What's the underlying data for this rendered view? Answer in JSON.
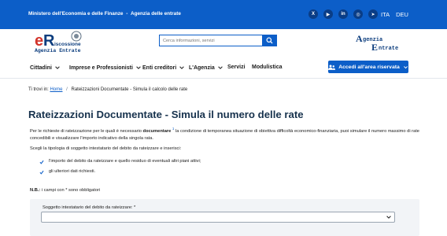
{
  "topbar": {
    "link1": "Ministero dell'Economia e delle Finanze",
    "separator": "-",
    "link2": "Agenzia delle entrate",
    "socials": [
      {
        "icon": "x-icon",
        "glyph": "X"
      },
      {
        "icon": "youtube-icon",
        "glyph": "▶"
      },
      {
        "icon": "linkedin-icon",
        "glyph": "in"
      },
      {
        "icon": "whatsapp-icon",
        "glyph": "◎"
      },
      {
        "icon": "telegram-icon",
        "glyph": "➤"
      }
    ],
    "lang_it": "ITA",
    "lang_de": "DEU"
  },
  "header": {
    "logo_left_alt": "Riscossione Agenzia Entrate",
    "logo_left_text1": "iscossione",
    "logo_left_text2": "Agenzia Entrate",
    "search_placeholder": "Cerca informazioni, servizi",
    "logo_right_text1": "genzia",
    "logo_right_text2": "ntrate"
  },
  "nav": {
    "items": [
      "Cittadini",
      "Imprese e Professionisti",
      "Enti creditori",
      "L'Agenzia",
      "Servizi",
      "Modulistica"
    ],
    "reserved_label": "Accedi all'area riservata"
  },
  "breadcrumb": {
    "prefix": "Ti trovi in:",
    "home": "Home",
    "current": "Rateizzazioni Documentate - Simula il calcolo delle rate"
  },
  "page": {
    "title": "Rateizzazioni Documentate - Simula il numero delle rate",
    "intro_a": "Per le richieste di rateizzazione per le quali è necessario ",
    "intro_b": "documentare",
    "intro_sup": "1",
    "intro_c": " la condizione di temporanea situazione di obiettiva difficoltà economico-finanziaria, puoi simulare il numero massimo di rate concedibili e visualizzare l'importo indicativo della singola rata.",
    "choose": "Scegli la tipologia di soggetto intestatario del debito da rateizzare e inserisci:",
    "checks": [
      "l'importo del debito da rateizzare e quello residuo di eventuali altri piani attivi;",
      "gli ulteriori dati richiesti."
    ],
    "note_bold": "N.B.:",
    "note_rest": " i campi con * sono obbligatori",
    "field_label": "Soggetto intestatario del debito da rateizzare: *",
    "select_value": ""
  },
  "colors": {
    "brand_blue": "#0c5ec8",
    "title_dark": "#17324d"
  }
}
